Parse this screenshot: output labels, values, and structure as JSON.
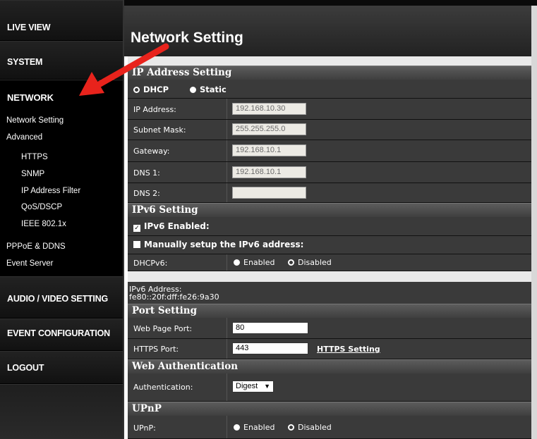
{
  "sidebar": {
    "live_view": "LIVE VIEW",
    "system": "SYSTEM",
    "network": "NETWORK",
    "sub": {
      "network_setting": "Network Setting",
      "advanced": "Advanced",
      "https": "HTTPS",
      "snmp": "SNMP",
      "ip_filter": "IP Address Filter",
      "qos": "QoS/DSCP",
      "ieee": "IEEE 802.1x",
      "pppoe": "PPPoE & DDNS",
      "event_server": "Event Server"
    },
    "audio_video": "AUDIO / VIDEO SETTING",
    "event_config": "EVENT CONFIGURATION",
    "logout": "LOGOUT"
  },
  "page": {
    "title": "Network Setting"
  },
  "ip_section": {
    "heading": "IP Address Setting",
    "dhcp_label": "DHCP",
    "static_label": "Static",
    "selected_mode": "DHCP",
    "ip_label": "IP Address:",
    "ip_value": "192.168.10.30",
    "mask_label": "Subnet Mask:",
    "mask_value": "255.255.255.0",
    "gateway_label": "Gateway:",
    "gateway_value": "192.168.10.1",
    "dns1_label": "DNS 1:",
    "dns1_value": "192.168.10.1",
    "dns2_label": "DNS 2:",
    "dns2_value": ""
  },
  "ipv6_section": {
    "heading": "IPv6 Setting",
    "enabled_label": "IPv6 Enabled:",
    "enabled_checked": true,
    "manual_label": "Manually setup the IPv6 address:",
    "manual_checked": false,
    "dhcpv6_label": "DHCPv6:",
    "dhcpv6_enabled": "Enabled",
    "dhcpv6_disabled": "Disabled",
    "dhcpv6_selected": "Enabled",
    "address_label": "IPv6 Address:",
    "address_value": "fe80::20f:dff:fe26:9a30"
  },
  "port_section": {
    "heading": "Port Setting",
    "web_label": "Web Page Port:",
    "web_value": "80",
    "https_label": "HTTPS Port:",
    "https_value": "443",
    "https_link": "HTTPS Setting"
  },
  "auth_section": {
    "heading": "Web Authentication",
    "auth_label": "Authentication:",
    "auth_value": "Digest"
  },
  "upnp_section": {
    "heading": "UPnP",
    "upnp_label": "UPnP:",
    "enabled": "Enabled",
    "disabled": "Disabled",
    "selected": "Enabled"
  },
  "colors": {
    "annotation_arrow": "#e8231c",
    "panel_dark": "#3a3a3a",
    "header": "#4a4a4a"
  },
  "icons": {
    "annotation": "red-arrow-icon",
    "dropdown": "dropdown-arrow-icon"
  }
}
